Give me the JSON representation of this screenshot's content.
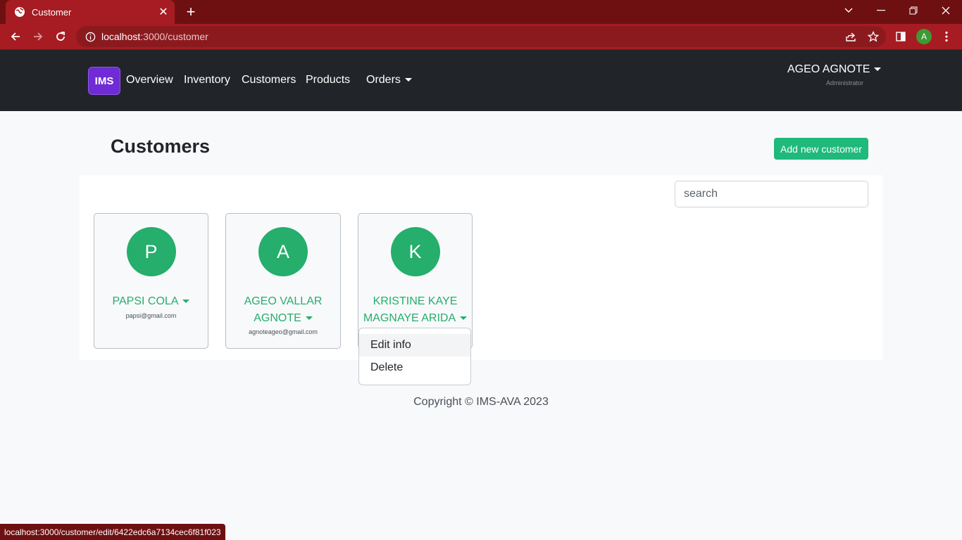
{
  "browser": {
    "tab_title": "Customer",
    "url_host": "localhost",
    "url_rest": ":3000/customer",
    "profile_initial": "A",
    "status_url": "localhost:3000/customer/edit/6422edc6a7134cec6f81f023"
  },
  "nav": {
    "brand": "IMS",
    "links": [
      "Overview",
      "Inventory",
      "Customers",
      "Products",
      "Orders"
    ],
    "user_name": "AGEO AGNOTE",
    "user_role": "Administrator"
  },
  "page": {
    "title": "Customers",
    "add_button": "Add new customer",
    "search_placeholder": "search"
  },
  "customers": [
    {
      "initial": "P",
      "name_line1": "PAPSI COLA",
      "name_line2": "",
      "email": "papsi@gmail.com"
    },
    {
      "initial": "A",
      "name_line1": "AGEO VALLAR",
      "name_line2": "AGNOTE",
      "email": "agnoteageo@gmail.com"
    },
    {
      "initial": "K",
      "name_line1": "KRISTINE KAYE",
      "name_line2": "MAGNAYE ARIDA",
      "email": ""
    }
  ],
  "dropdown": {
    "items": [
      "Edit info",
      "Delete"
    ]
  },
  "footer": "Copyright © IMS-AVA 2023",
  "colors": {
    "accent": "#1fb97b",
    "avatar": "#25ae6c",
    "brand": "#6f2bd6",
    "navbar": "#212529",
    "chrome": "#a61c22"
  }
}
